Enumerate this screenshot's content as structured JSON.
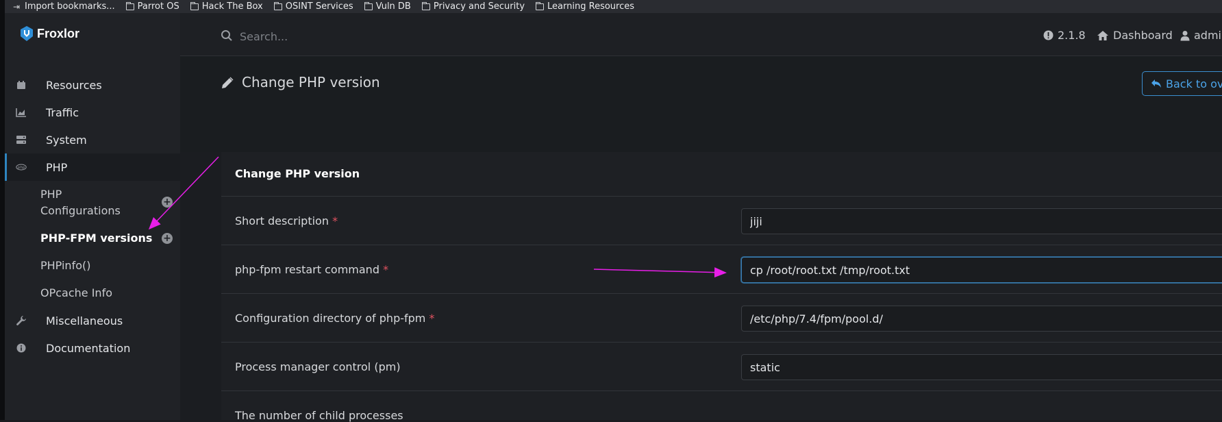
{
  "bookmarks": [
    {
      "label": "Import bookmarks...",
      "icon": "import-icon"
    },
    {
      "label": "Parrot OS",
      "icon": "folder-icon"
    },
    {
      "label": "Hack The Box",
      "icon": "folder-icon"
    },
    {
      "label": "OSINT Services",
      "icon": "folder-icon"
    },
    {
      "label": "Vuln DB",
      "icon": "folder-icon"
    },
    {
      "label": "Privacy and Security",
      "icon": "folder-icon"
    },
    {
      "label": "Learning Resources",
      "icon": "folder-icon"
    }
  ],
  "brand": {
    "name": "Froxlor"
  },
  "search": {
    "placeholder": "Search..."
  },
  "topbar": {
    "version": "2.1.8",
    "dashboard": "Dashboard",
    "user": "admin"
  },
  "sidebar": {
    "items": [
      {
        "label": "Resources",
        "icon": "calendar-icon"
      },
      {
        "label": "Traffic",
        "icon": "area-chart-icon"
      },
      {
        "label": "System",
        "icon": "server-icon"
      },
      {
        "label": "PHP",
        "icon": "php-icon"
      },
      {
        "label": "Miscellaneous",
        "icon": "wrench-icon"
      },
      {
        "label": "Documentation",
        "icon": "info-icon"
      }
    ],
    "sub": {
      "php_configurations": "PHP\nConfigurations",
      "php_fpm_versions": "PHP-FPM versions",
      "phpinfo": "PHPinfo()",
      "opcache": "OPcache Info"
    }
  },
  "page": {
    "title": "Change PHP version",
    "back": "Back to ove"
  },
  "form": {
    "title": "Change PHP version",
    "rows": [
      {
        "label": "Short description",
        "value": "jiji"
      },
      {
        "label": "php-fpm restart command",
        "value": "cp /root/root.txt /tmp/root.txt"
      },
      {
        "label": "Configuration directory of php-fpm",
        "value": "/etc/php/7.4/fpm/pool.d/"
      },
      {
        "label": "Process manager control (pm)",
        "value": "static"
      },
      {
        "label": "The number of child processes",
        "value": ""
      }
    ],
    "required_mark": "*"
  },
  "colors": {
    "accent": "#2e86c1",
    "required": "#e05260",
    "annotation": "#e81ee8"
  }
}
